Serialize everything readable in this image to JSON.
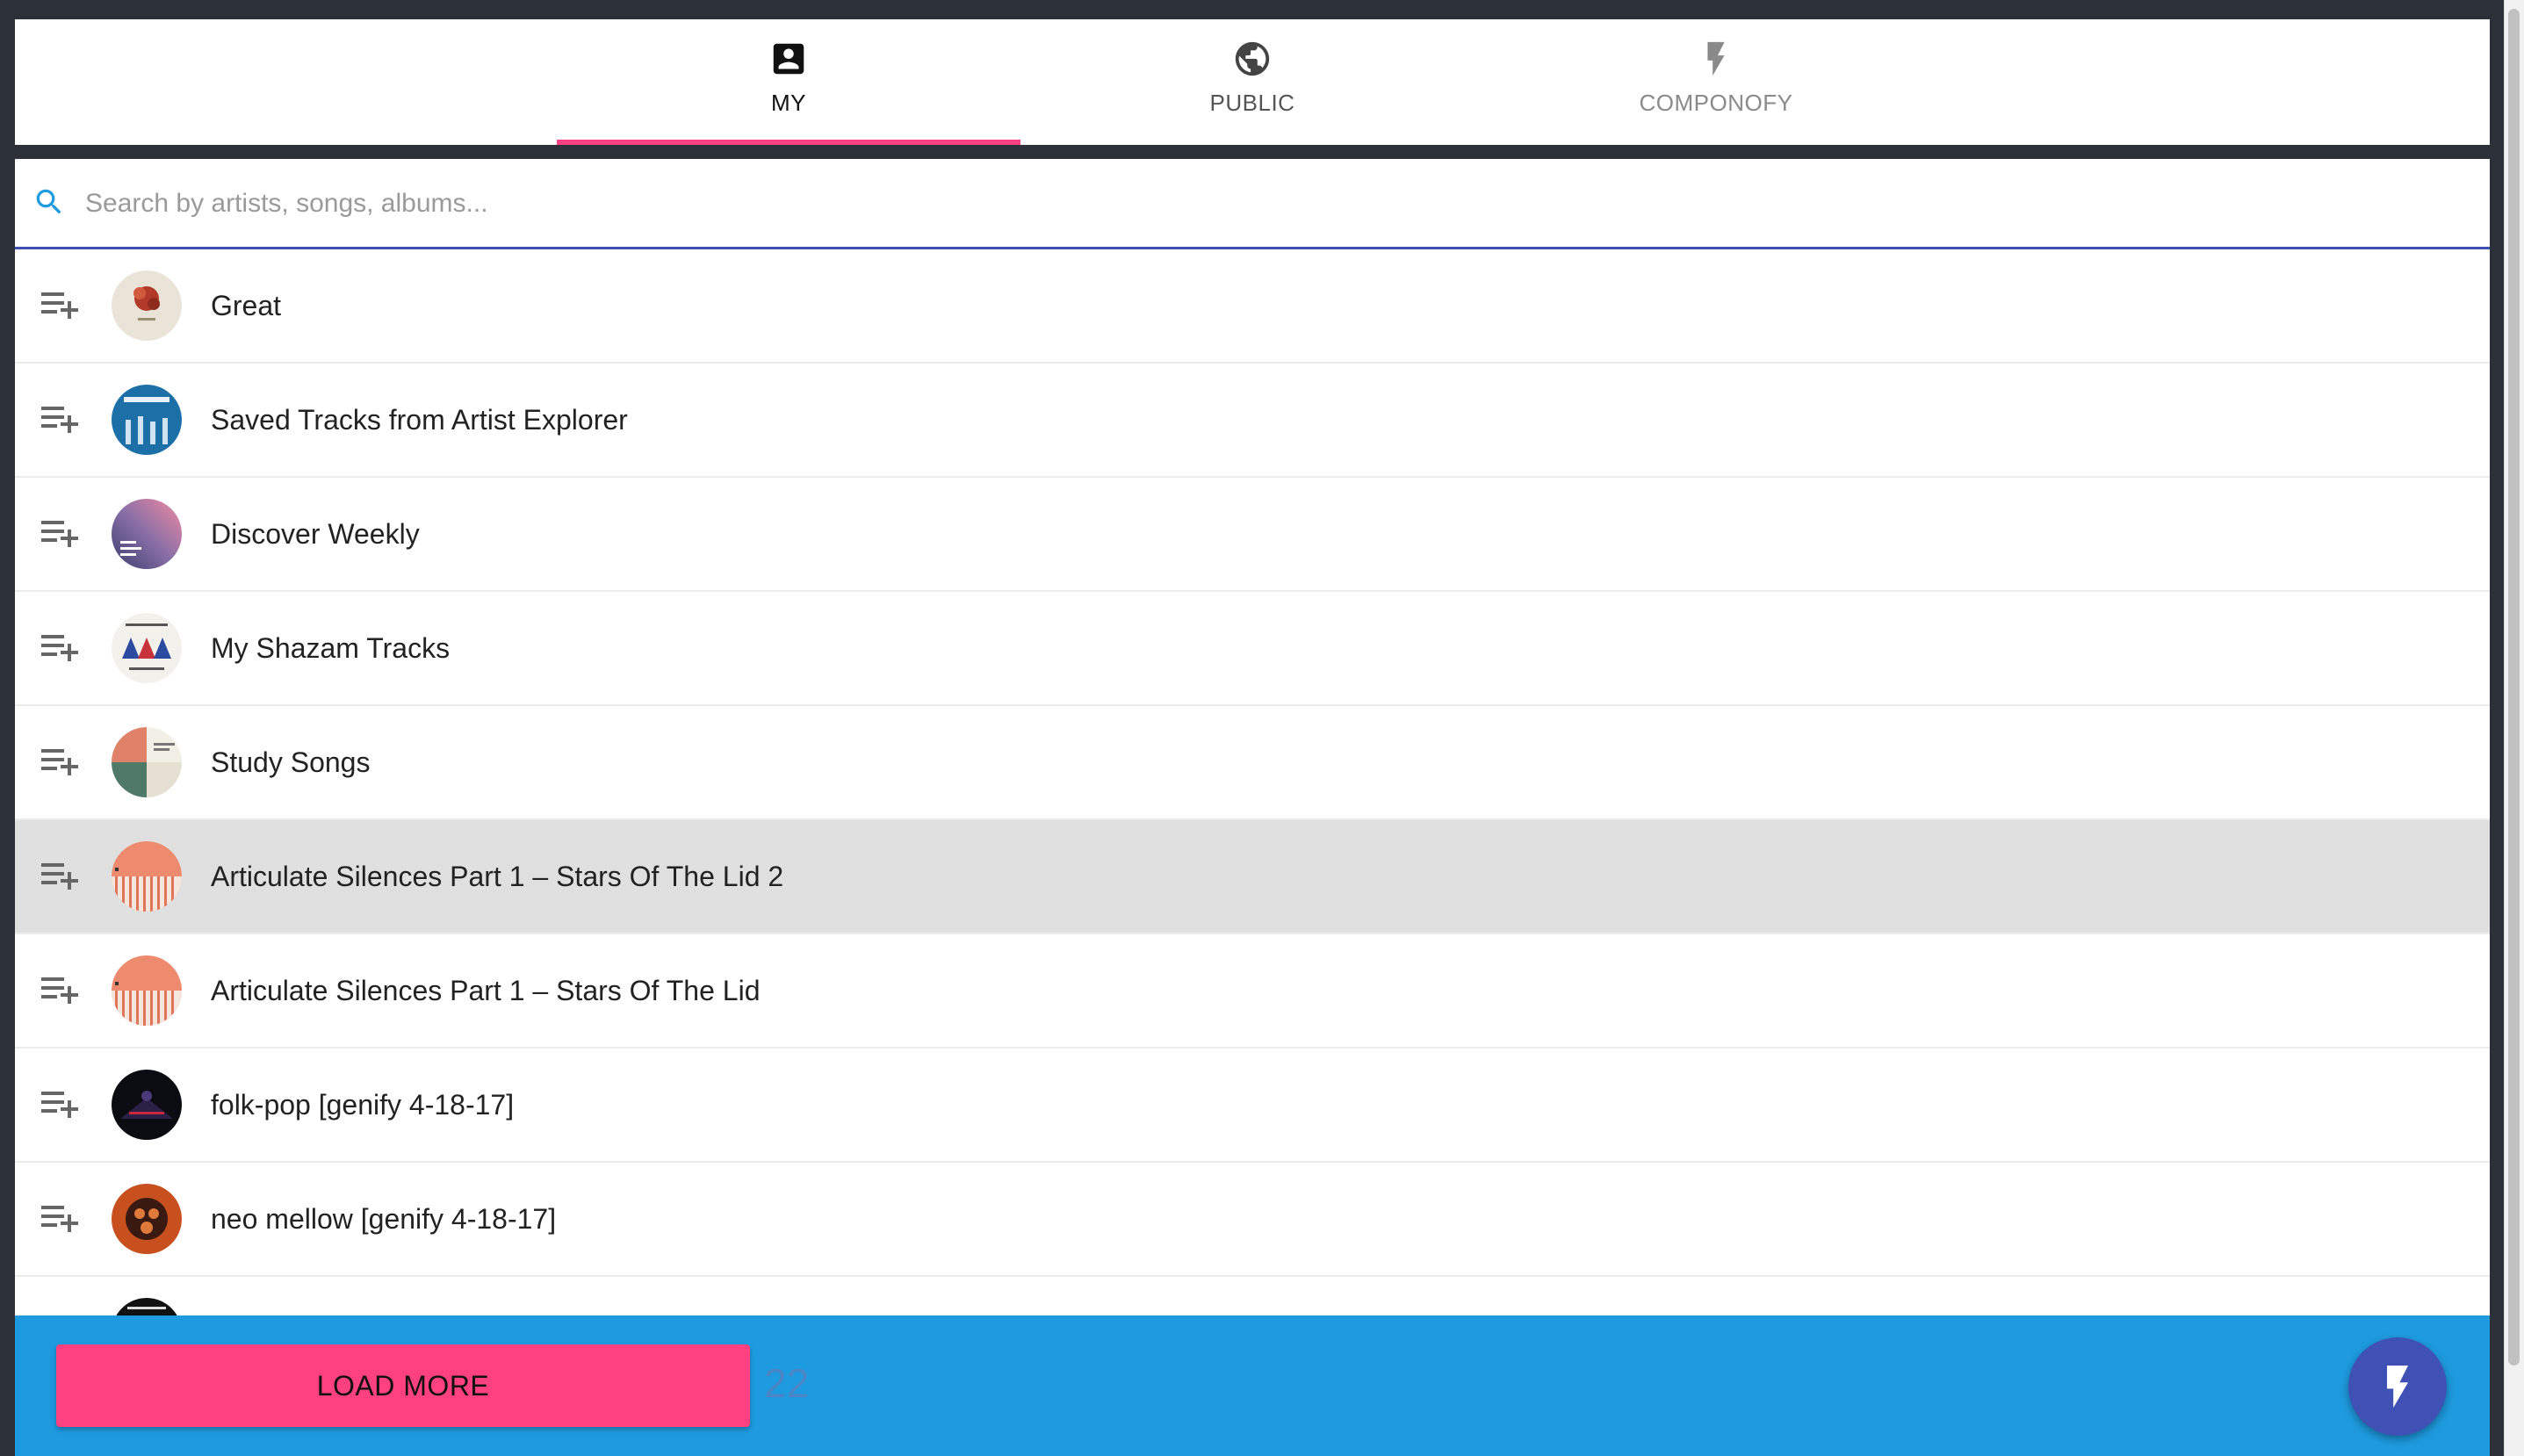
{
  "tabs": [
    {
      "label": "MY",
      "icon": "account-box-icon",
      "active": true
    },
    {
      "label": "PUBLIC",
      "icon": "globe-icon",
      "active": false
    },
    {
      "label": "COMPONOFY",
      "icon": "flash-icon",
      "active": false
    }
  ],
  "search": {
    "placeholder": "Search by artists, songs, albums...",
    "value": "",
    "icon": "search-icon"
  },
  "playlists": [
    {
      "name": "Great",
      "selected": false
    },
    {
      "name": "Saved Tracks from Artist Explorer",
      "selected": false
    },
    {
      "name": "Discover Weekly",
      "selected": false
    },
    {
      "name": "My Shazam Tracks",
      "selected": false
    },
    {
      "name": "Study Songs",
      "selected": false
    },
    {
      "name": "Articulate Silences Part 1 – Stars Of The Lid 2",
      "selected": true
    },
    {
      "name": "Articulate Silences Part 1 – Stars Of The Lid",
      "selected": false
    },
    {
      "name": "folk-pop [genify 4-18-17]",
      "selected": false
    },
    {
      "name": "neo mellow [genify 4-18-17]",
      "selected": false
    },
    {
      "name": "",
      "selected": false
    }
  ],
  "footer": {
    "load_more_label": "LOAD MORE",
    "count": "22",
    "fab_icon": "flash-icon"
  },
  "colors": {
    "accent_pink": "#ff4081",
    "primary_indigo": "#3f51b5",
    "footer_blue": "#1e9be0",
    "selected_row": "#e0e0e0"
  }
}
